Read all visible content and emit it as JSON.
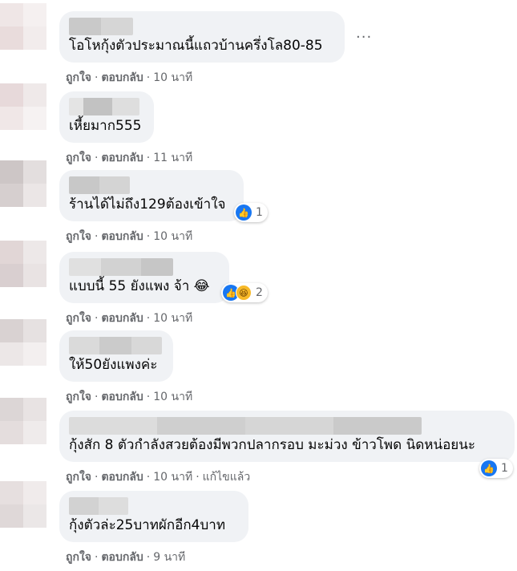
{
  "comments": [
    {
      "name": "",
      "text": "โอโหกุ้งตัวประมาณนี้แถวบ้านครึ่งโล80-85",
      "like": "ถูกใจ",
      "reply": "ตอบกลับ",
      "time": "10 นาที",
      "more_icon": "more-horizontal-icon"
    },
    {
      "name": "",
      "text": "เหี้ยมาก555",
      "like": "ถูกใจ",
      "reply": "ตอบกลับ",
      "time": "11 นาที"
    },
    {
      "name": "",
      "text": "ร้านได้ไม่ถึง129ต้องเข้าใจ",
      "like": "ถูกใจ",
      "reply": "ตอบกลับ",
      "time": "10 นาที",
      "reactions": {
        "icons": [
          "like-icon"
        ],
        "count": "1"
      }
    },
    {
      "name": "",
      "text": "แบบนี้ 55 ยังแพง จ้า 😂",
      "like": "ถูกใจ",
      "reply": "ตอบกลับ",
      "time": "10 นาที",
      "reactions": {
        "icons": [
          "like-icon",
          "haha-icon"
        ],
        "count": "2"
      }
    },
    {
      "name": "",
      "text": "ให้50ยังแพงค่ะ",
      "like": "ถูกใจ",
      "reply": "ตอบกลับ",
      "time": "10 นาที"
    },
    {
      "name": "",
      "text": "กุ้งสัก 8 ตัวกำลังสวยต้องมีพวกปลากรอบ มะม่วง ข้าวโพด นิดหน่อยนะ",
      "like": "ถูกใจ",
      "reply": "ตอบกลับ",
      "time": "10 นาที",
      "edited": "แก้ไขแล้ว",
      "reactions": {
        "icons": [
          "like-icon"
        ],
        "count": "1"
      }
    },
    {
      "name": "",
      "text": "กุ้งตัวล่ะ25บาทผักอีก4บาท",
      "like": "ถูกใจ",
      "reply": "ตอบกลับ",
      "time": "9 นาที"
    }
  ],
  "colors": {
    "bubble": "#f0f2f5",
    "meta_text": "#65676b",
    "like_blue": "#1877f2",
    "haha_yellow": "#f7b928"
  },
  "dot_separator": "·",
  "more_glyph": "···"
}
